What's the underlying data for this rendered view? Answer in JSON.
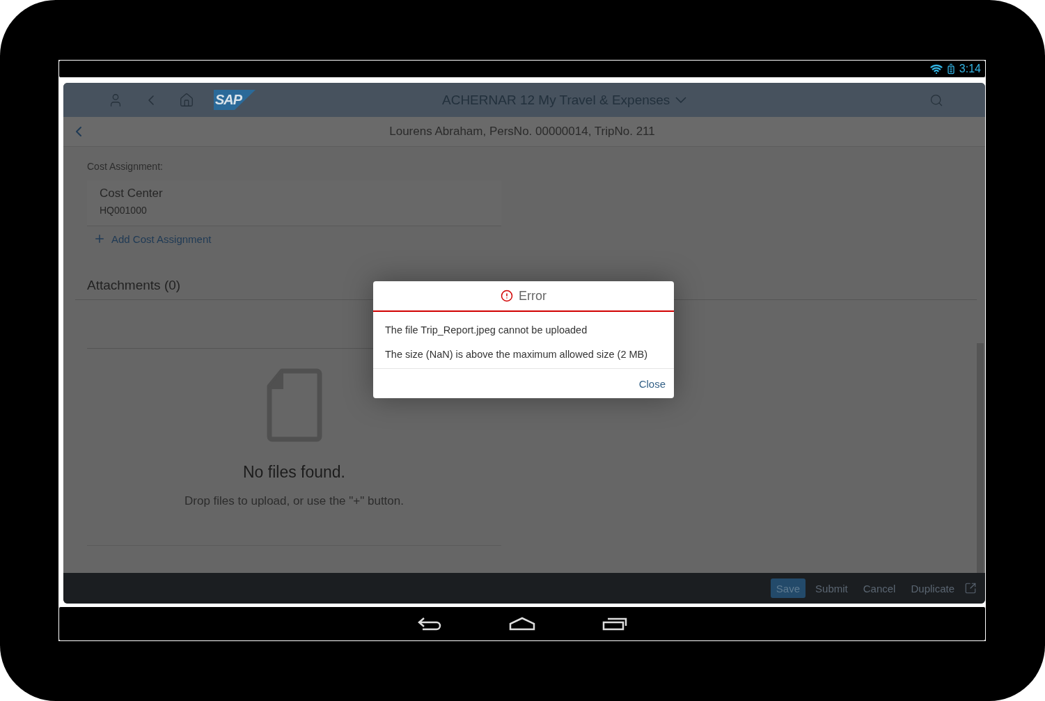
{
  "status_bar": {
    "time": "3:14"
  },
  "shell": {
    "logo": "SAP",
    "title": "ACHERNAR 12 My Travel & Expenses"
  },
  "page": {
    "title": "Lourens Abraham, PersNo. 00000014, TripNo. 211"
  },
  "cost_assignment": {
    "label": "Cost Assignment:",
    "items": [
      {
        "name": "Cost Center",
        "value": "HQ001000"
      }
    ],
    "add_link": "Add Cost Assignment"
  },
  "attachments": {
    "title": "Attachments (0)",
    "empty_title": "No files found.",
    "empty_text": "Drop files to upload, or use the \"+\" button."
  },
  "footer": {
    "buttons": [
      {
        "label": "Save",
        "kind": "emphasized"
      },
      {
        "label": "Submit",
        "kind": "plain"
      },
      {
        "label": "Cancel",
        "kind": "plain"
      },
      {
        "label": "Duplicate",
        "kind": "plain"
      }
    ]
  },
  "dialog": {
    "kind": "error",
    "title": "Error",
    "messages": [
      "The file Trip_Report.jpeg cannot be uploaded",
      "The size (NaN) is above the maximum allowed size (2 MB)"
    ],
    "close": "Close"
  }
}
